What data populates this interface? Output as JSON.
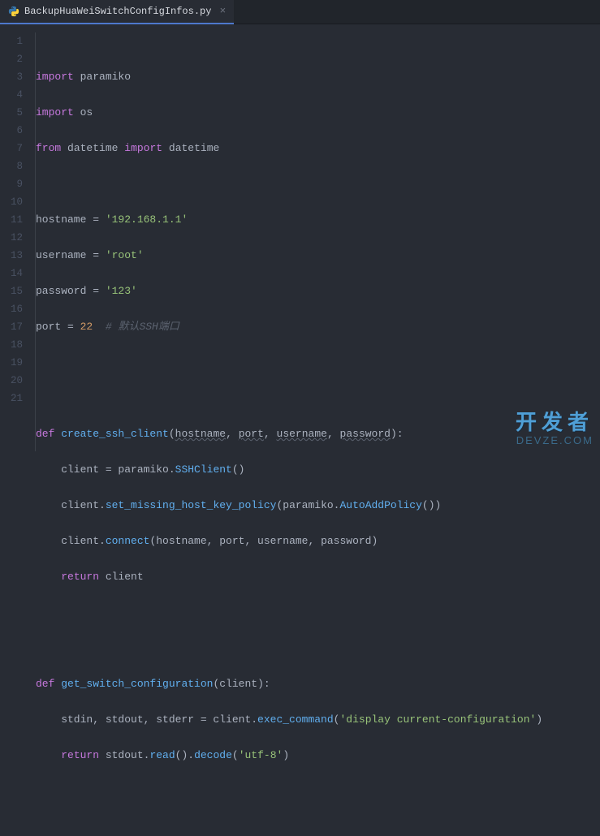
{
  "tab": {
    "filename": "BackupHuaWeiSwitchConfigInfos.py",
    "close_glyph": "×"
  },
  "gutter": {
    "start": 1,
    "end": 21
  },
  "code": {
    "l1": {
      "kw1": "import",
      "id1": "paramiko"
    },
    "l2": {
      "kw1": "import",
      "id1": "os"
    },
    "l3": {
      "kw1": "from",
      "id1": "datetime",
      "kw2": "import",
      "id2": "datetime"
    },
    "l5": {
      "id": "hostname",
      "eq": " = ",
      "str": "'192.168.1.1'"
    },
    "l6": {
      "id": "username",
      "eq": " = ",
      "str": "'root'"
    },
    "l7": {
      "id": "password",
      "eq": " = ",
      "str": "'123'"
    },
    "l8": {
      "id": "port",
      "eq": " = ",
      "num": "22",
      "cm": "  # 默认SSH端口"
    },
    "l11": {
      "kw": "def",
      "fn": "create_ssh_client",
      "params": "hostname, port, username, password",
      "p1": "hostname",
      "p2": "port",
      "p3": "username",
      "p4": "password"
    },
    "l12": {
      "txt1": "    client = paramiko.",
      "fn": "SSHClient",
      "txt2": "()"
    },
    "l13": {
      "txt1": "    client.",
      "fn": "set_missing_host_key_policy",
      "txt2": "(paramiko.",
      "fn2": "AutoAddPolicy",
      "txt3": "())"
    },
    "l14": {
      "txt1": "    client.",
      "fn": "connect",
      "txt2": "(hostname, port, username, password)"
    },
    "l15": {
      "kw": "return",
      "txt": " client"
    },
    "l18": {
      "kw": "def",
      "fn": "get_switch_configuration",
      "params": "client"
    },
    "l19": {
      "txt1": "    stdin, stdout, stderr = client.",
      "fn": "exec_command",
      "txt2": "(",
      "str": "'display current-configuration'",
      "txt3": ")"
    },
    "l20": {
      "kw": "return",
      "txt1": " stdout.",
      "fn1": "read",
      "txt2": "().",
      "fn2": "decode",
      "txt3": "(",
      "str": "'utf-8'",
      "txt4": ")"
    }
  },
  "watermark": {
    "top": "开发者",
    "bottom": "DEVZE.COM"
  }
}
